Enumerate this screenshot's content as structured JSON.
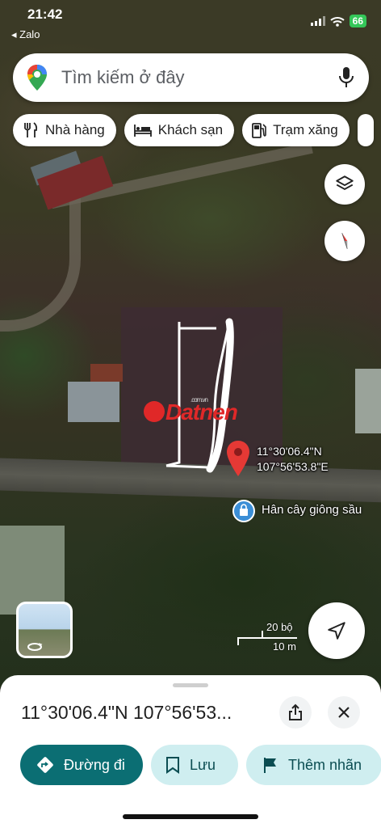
{
  "status": {
    "time": "21:42",
    "back_app": "◂ Zalo",
    "battery": "66"
  },
  "search": {
    "placeholder": "Tìm kiếm ở đây"
  },
  "chips": [
    {
      "label": "Nhà hàng",
      "icon": "restaurant-icon"
    },
    {
      "label": "Khách sạn",
      "icon": "hotel-icon"
    },
    {
      "label": "Trạm xăng",
      "icon": "gas-station-icon"
    }
  ],
  "map": {
    "watermark": "Datnen",
    "watermark_small": ".com.vn",
    "pin_coords_line1": "11°30'06.4\"N",
    "pin_coords_line2": "107°56'53.8\"E",
    "nearby_place": "Hân cây giông sầu",
    "scale_top": "20 bộ",
    "scale_bottom": "10 m"
  },
  "sheet": {
    "title": "11°30'06.4\"N 107°56'53...",
    "directions_label": "Đường đi",
    "save_label": "Lưu",
    "add_label_label": "Thêm nhãn"
  },
  "colors": {
    "primary": "#0b6e73",
    "secondary": "#cfeef0",
    "pin": "#e53935",
    "battery": "#34c759"
  }
}
